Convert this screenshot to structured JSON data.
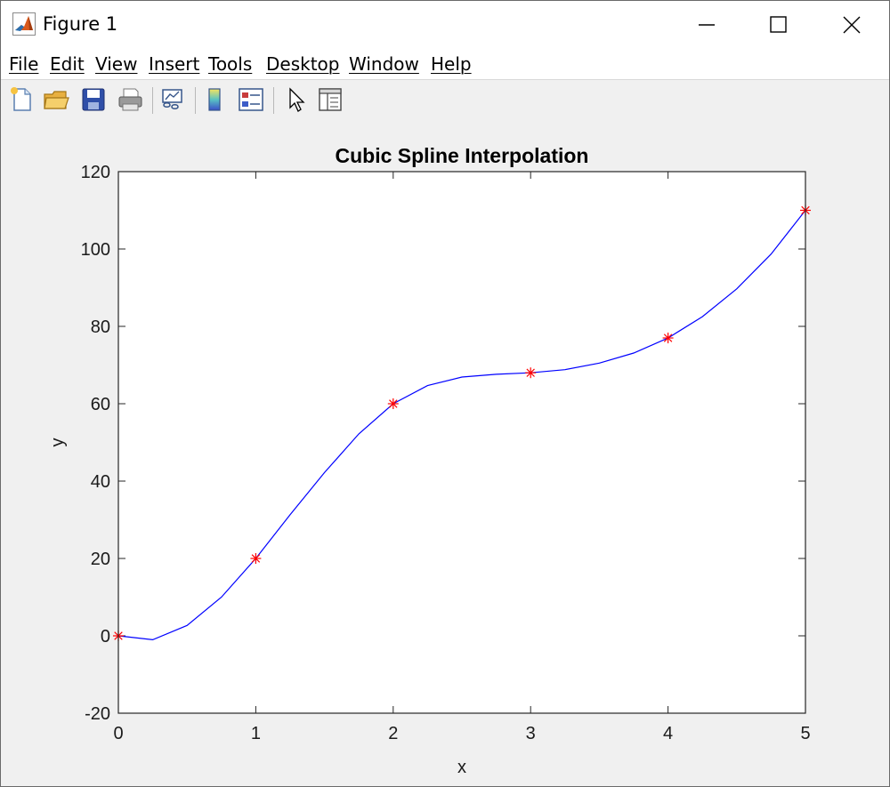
{
  "window": {
    "title": "Figure 1"
  },
  "menu": [
    "File",
    "Edit",
    "View",
    "Insert",
    "Tools",
    "Desktop",
    "Window",
    "Help"
  ],
  "toolbar": {
    "buttons": [
      "new-figure-icon",
      "open-file-icon",
      "save-icon",
      "print-icon",
      "link-plot-icon",
      "colorbar-icon",
      "legend-icon",
      "pointer-icon",
      "property-inspector-icon"
    ]
  },
  "colors": {
    "line": "#0000ff",
    "marker": "#ff0000",
    "axes_background": "#ffffff",
    "figure_background": "#f0f0f0"
  },
  "chart_data": {
    "type": "line",
    "title": "Cubic Spline Interpolation",
    "xlabel": "x",
    "ylabel": "y",
    "xlim": [
      0,
      5
    ],
    "ylim": [
      -20,
      120
    ],
    "xticks": [
      "0",
      "1",
      "2",
      "3",
      "4",
      "5"
    ],
    "yticks": [
      "-20",
      "0",
      "20",
      "40",
      "60",
      "80",
      "100",
      "120"
    ],
    "grid": false,
    "series": [
      {
        "style": "line",
        "color": "#0000ff",
        "x": [
          0,
          0.25,
          0.5,
          0.75,
          1,
          1.25,
          1.5,
          1.75,
          2,
          2.25,
          2.5,
          2.75,
          3,
          3.25,
          3.5,
          3.75,
          4,
          4.25,
          4.5,
          4.75,
          5
        ],
        "y": [
          0,
          -1,
          2.7,
          10,
          20,
          31.3,
          42.2,
          52.2,
          60,
          64.7,
          66.9,
          67.6,
          68,
          68.8,
          70.5,
          73.1,
          77,
          82.5,
          89.7,
          98.7,
          110
        ]
      },
      {
        "style": "markers",
        "marker": "*",
        "color": "#ff0000",
        "x": [
          0,
          1,
          2,
          3,
          4,
          5
        ],
        "y": [
          0,
          20,
          60,
          68,
          77,
          110
        ]
      }
    ]
  }
}
